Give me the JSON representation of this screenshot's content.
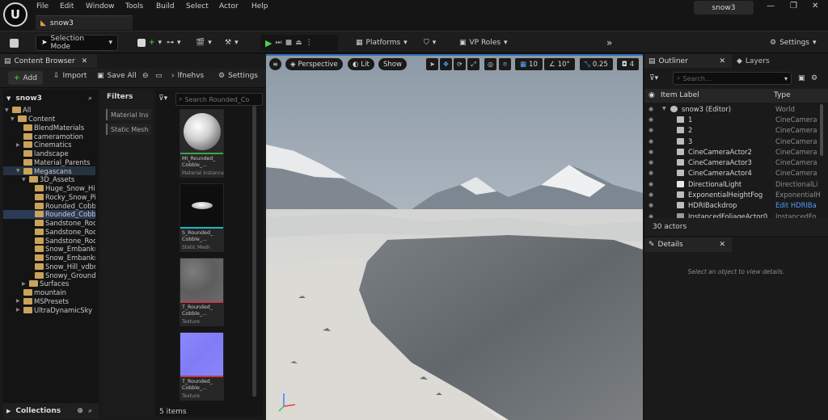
{
  "app": {
    "logo": "U",
    "title": "snow3",
    "project_tab": "snow3"
  },
  "menu": [
    "File",
    "Edit",
    "Window",
    "Tools",
    "Build",
    "Select",
    "Actor",
    "Help"
  ],
  "window_controls": {
    "minimize": "—",
    "restore": "❐",
    "close": "✕"
  },
  "toolbar": {
    "selection_mode": "Selection Mode",
    "platforms": "Platforms",
    "vp_roles": "VP Roles",
    "settings": "Settings"
  },
  "content_browser": {
    "tab_label": "Content Browser",
    "add": "Add",
    "import": "Import",
    "save_all": "Save All",
    "path": "lfnehvs",
    "settings": "Settings",
    "tree_root": "snow3",
    "tree": [
      {
        "label": "All",
        "depth": 0,
        "state": "expanded"
      },
      {
        "label": "Content",
        "depth": 1,
        "state": "expanded"
      },
      {
        "label": "BlendMaterials",
        "depth": 2,
        "state": "leaf"
      },
      {
        "label": "cameramotion",
        "depth": 2,
        "state": "leaf"
      },
      {
        "label": "Cinematics",
        "depth": 2,
        "state": "collapsed"
      },
      {
        "label": "landscape",
        "depth": 2,
        "state": "leaf"
      },
      {
        "label": "Material_Parents",
        "depth": 2,
        "state": "leaf"
      },
      {
        "label": "Megascans",
        "depth": 2,
        "state": "expanded"
      },
      {
        "label": "3D_Assets",
        "depth": 3,
        "state": "expanded"
      },
      {
        "label": "Huge_Snow_Hil",
        "depth": 4,
        "state": "leaf"
      },
      {
        "label": "Rocky_Snow_Pi",
        "depth": 4,
        "state": "leaf"
      },
      {
        "label": "Rounded_Cobb",
        "depth": 4,
        "state": "leaf"
      },
      {
        "label": "Rounded_Cobb",
        "depth": 4,
        "state": "selected"
      },
      {
        "label": "Sandstone_Roc",
        "depth": 4,
        "state": "leaf"
      },
      {
        "label": "Sandstone_Roc",
        "depth": 4,
        "state": "leaf"
      },
      {
        "label": "Sandstone_Roc",
        "depth": 4,
        "state": "leaf"
      },
      {
        "label": "Snow_Embankn",
        "depth": 4,
        "state": "leaf"
      },
      {
        "label": "Snow_Embankn",
        "depth": 4,
        "state": "leaf"
      },
      {
        "label": "Snow_Hill_vdbn",
        "depth": 4,
        "state": "leaf"
      },
      {
        "label": "Snowy_Ground_",
        "depth": 4,
        "state": "leaf"
      },
      {
        "label": "Surfaces",
        "depth": 3,
        "state": "collapsed"
      },
      {
        "label": "mountain",
        "depth": 2,
        "state": "leaf"
      },
      {
        "label": "MSPresets",
        "depth": 2,
        "state": "collapsed"
      },
      {
        "label": "UltraDynamicSky",
        "depth": 2,
        "state": "collapsed"
      }
    ],
    "collections": "Collections",
    "filters_title": "Filters",
    "filter_tags": [
      "Material Ins",
      "Static Mesh"
    ],
    "search_placeholder": "Search Rounded_Co",
    "assets": [
      {
        "name": "MI_Rounded_ Cobble_...",
        "type": "Material Instance",
        "bar": "#38a84a",
        "kind": "sphere"
      },
      {
        "name": "S_Rounded_ Cobble_...",
        "type": "Static Mesh",
        "bar": "#19b8c4",
        "kind": "mesh"
      },
      {
        "name": "T_Rounded_ Cobble_...",
        "type": "Texture",
        "bar": "#c23a4a",
        "kind": "texture"
      },
      {
        "name": "T_Rounded_ Cobble_...",
        "type": "Texture",
        "bar": "#c23a4a",
        "kind": "normal"
      }
    ],
    "items_count": "5 items"
  },
  "viewport": {
    "perspective": "Perspective",
    "lit": "Lit",
    "show": "Show",
    "grid_size": "10",
    "rotation_snap": "10°",
    "scale_snap": "0.25",
    "camera_speed": "4"
  },
  "outliner": {
    "tab_label": "Outliner",
    "layers_tab": "Layers",
    "search_placeholder": "Search...",
    "col_label": "Item Label",
    "col_type": "Type",
    "rows": [
      {
        "name": "snow3 (Editor)",
        "type": "World",
        "indent": 1,
        "icon": "world"
      },
      {
        "name": "1",
        "type": "CineCamera",
        "indent": 2,
        "icon": "camera"
      },
      {
        "name": "2",
        "type": "CineCamera",
        "indent": 2,
        "icon": "camera"
      },
      {
        "name": "3",
        "type": "CineCamera",
        "indent": 2,
        "icon": "camera"
      },
      {
        "name": "CineCameraActor2",
        "type": "CineCamera",
        "indent": 2,
        "icon": "camera"
      },
      {
        "name": "CineCameraActor3",
        "type": "CineCamera",
        "indent": 2,
        "icon": "camera"
      },
      {
        "name": "CineCameraActor4",
        "type": "CineCamera",
        "indent": 2,
        "icon": "camera"
      },
      {
        "name": "DirectionalLight",
        "type": "DirectionalLi",
        "indent": 2,
        "icon": "light"
      },
      {
        "name": "ExponentialHeightFog",
        "type": "ExponentialH",
        "indent": 2,
        "icon": "fog"
      },
      {
        "name": "HDRIBackdrop",
        "type": "Edit HDRIBa",
        "indent": 2,
        "icon": "backdrop",
        "type_link": true
      },
      {
        "name": "InstancedFoliageActor0",
        "type": "InstancedFo",
        "indent": 2,
        "icon": "foliage"
      }
    ],
    "actors_count": "30 actors"
  },
  "details": {
    "tab_label": "Details",
    "empty_text": "Select an object to view details."
  }
}
